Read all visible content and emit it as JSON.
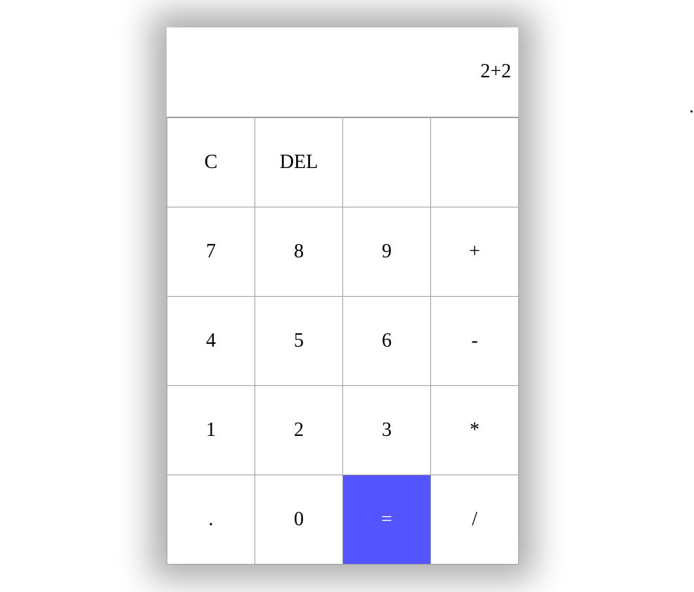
{
  "display": {
    "expression": "2+2"
  },
  "keypad": {
    "rows": [
      [
        {
          "label": "C",
          "name": "clear-button"
        },
        {
          "label": "DEL",
          "name": "delete-button"
        },
        {
          "label": "",
          "name": "blank-button-1"
        },
        {
          "label": "",
          "name": "blank-button-2"
        }
      ],
      [
        {
          "label": "7",
          "name": "digit-7-button"
        },
        {
          "label": "8",
          "name": "digit-8-button"
        },
        {
          "label": "9",
          "name": "digit-9-button"
        },
        {
          "label": "+",
          "name": "plus-button"
        }
      ],
      [
        {
          "label": "4",
          "name": "digit-4-button"
        },
        {
          "label": "5",
          "name": "digit-5-button"
        },
        {
          "label": "6",
          "name": "digit-6-button"
        },
        {
          "label": "-",
          "name": "minus-button"
        }
      ],
      [
        {
          "label": "1",
          "name": "digit-1-button"
        },
        {
          "label": "2",
          "name": "digit-2-button"
        },
        {
          "label": "3",
          "name": "digit-3-button"
        },
        {
          "label": "*",
          "name": "multiply-button"
        }
      ],
      [
        {
          "label": ".",
          "name": "decimal-button"
        },
        {
          "label": "0",
          "name": "digit-0-button"
        },
        {
          "label": "=",
          "name": "equals-button",
          "accent": true
        },
        {
          "label": "/",
          "name": "divide-button"
        }
      ]
    ]
  },
  "colors": {
    "accent": "#5555ff",
    "border": "#9e9e9e",
    "background": "#ffffff"
  }
}
